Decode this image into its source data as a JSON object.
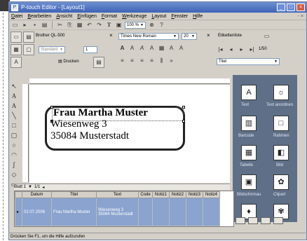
{
  "window": {
    "title": "P-touch Editor - [Layout1]",
    "app_icon": "P"
  },
  "menu": {
    "items": [
      "Datei",
      "Bearbeiten",
      "Ansicht",
      "Einfügen",
      "Format",
      "Werkzeuge",
      "Layout",
      "Fenster",
      "Hilfe"
    ]
  },
  "toolbar": {
    "zoom": "100 %"
  },
  "printer": {
    "name": "Brother QL-500",
    "standard": "Standard",
    "copies": "1",
    "print_label": "Drucken"
  },
  "font": {
    "name": "Times New Roman",
    "size": "20"
  },
  "labels_list": {
    "title": "Etikettenliste",
    "count": "1/50",
    "field": "Titel"
  },
  "label": {
    "line1": "Frau Martha Muster",
    "line2": "Wiesenweg 3",
    "line3": "35084 Musterstadt"
  },
  "tabs": {
    "sheet": "Blatt 1",
    "page": "1/1"
  },
  "grid": {
    "headers": [
      "Datum",
      "Titel",
      "Text",
      "Code",
      "Notiz1",
      "Notiz2",
      "Notiz3",
      "Notiz4"
    ],
    "row": {
      "date": "02.07.2006",
      "title": "Frau Martha Muster",
      "text1": "Wiesenweg 3",
      "text2": "35084 Musterstadt"
    }
  },
  "side": {
    "text": "Text",
    "text_arrange": "Text anordnen",
    "barcode": "Barcode",
    "frame": "Rahmen",
    "table": "Tabelle",
    "image": "Bild",
    "screenshot": "Bildschirmau",
    "clipart": "Clipart"
  },
  "status": "Drücken Sie F1, um die Hilfe aufzurufen"
}
